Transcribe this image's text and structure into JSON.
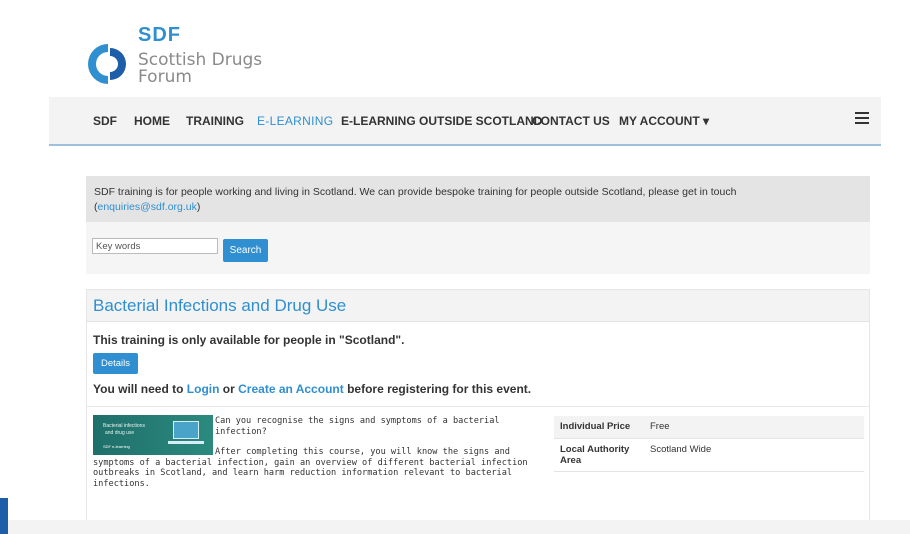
{
  "logo": {
    "abbr": "SDF",
    "line1": "Scottish Drugs",
    "line2": "Forum"
  },
  "nav": {
    "items": [
      "SDF",
      "HOME",
      "TRAINING",
      "E-LEARNING",
      "E-LEARNING OUTSIDE SCOTLAND",
      "CONTACT US",
      "MY ACCOUNT ▾"
    ],
    "active": "E-LEARNING",
    "menu_icon": "hamburger-icon"
  },
  "notice": {
    "text": "SDF training is for people working and living in Scotland. We can provide bespoke training for people outside Scotland, please get in touch",
    "email": "enquiries@sdf.org.uk"
  },
  "search": {
    "placeholder": "Key words",
    "value": "",
    "button": "Search"
  },
  "course": {
    "title": "Bacterial Infections and Drug Use",
    "availability": "This training is only available for people in \"Scotland\".",
    "details_button": "Details",
    "login_prefix": "You will need to",
    "login_link": "Login",
    "or_text": "or",
    "create_link": "Create an Account",
    "login_suffix": "before registering for this event.",
    "thumbnail": {
      "line1": "Bacterial infections",
      "line2": "and drug use",
      "badge": "SDF e-learning"
    },
    "description_1": "Can you recognise the signs and symptoms of a bacterial infection?",
    "description_2": "After completing this course, you will know the signs and symptoms of a bacterial infection, gain an overview of different bacterial infection outbreaks in Scotland, and learn harm reduction information relevant to bacterial infections.",
    "details": [
      {
        "label": "Individual Price",
        "value": "Free"
      },
      {
        "label": "Local Authority Area",
        "value": "Scotland Wide"
      }
    ]
  },
  "colors": {
    "accent": "#2f8fd0",
    "nav_bg": "#f3f3f3",
    "notice_bg": "#e4e4e4",
    "logo_dark": "#1e5ea8"
  }
}
